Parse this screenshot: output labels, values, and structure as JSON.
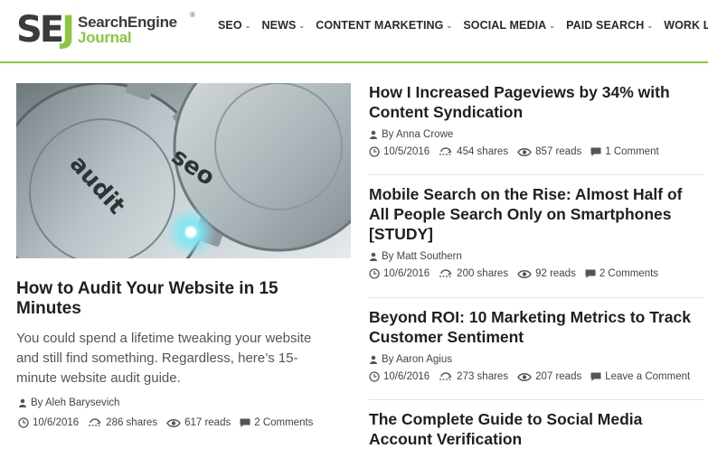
{
  "logo": {
    "mark_se": "SE",
    "mark_j": "J",
    "line1": "SearchEngine",
    "line2": "Journal",
    "reg": "®"
  },
  "nav": [
    {
      "label": "SEO"
    },
    {
      "label": "NEWS"
    },
    {
      "label": "CONTENT MARKETING"
    },
    {
      "label": "SOCIAL MEDIA"
    },
    {
      "label": "PAID SEARCH"
    },
    {
      "label": "WORK LIFE"
    }
  ],
  "featured": {
    "image_words": [
      "audit",
      "seo"
    ],
    "title": "How to Audit Your Website in 15 Minutes",
    "excerpt": "You could spend a lifetime tweaking your website and still find something. Regardless, here’s 15-minute website audit guide.",
    "author": "By Aleh Barysevich",
    "date": "10/6/2016",
    "shares": "286 shares",
    "reads": "617 reads",
    "comments": "2 Comments"
  },
  "articles": [
    {
      "title": "How I Increased Pageviews by 34% with Content Syndication",
      "author": "By Anna Crowe",
      "date": "10/5/2016",
      "shares": "454 shares",
      "reads": "857 reads",
      "comments": "1 Comment"
    },
    {
      "title": "Mobile Search on the Rise: Almost Half of All People Search Only on Smartphones [STUDY]",
      "author": "By Matt Southern",
      "date": "10/6/2016",
      "shares": "200 shares",
      "reads": "92 reads",
      "comments": "2 Comments"
    },
    {
      "title": "Beyond ROI: 10 Marketing Metrics to Track Customer Sentiment",
      "author": "By Aaron Agius",
      "date": "10/6/2016",
      "shares": "273 shares",
      "reads": "207 reads",
      "comments": "Leave a Comment"
    },
    {
      "title": "The Complete Guide to Social Media Account Verification"
    }
  ],
  "colors": {
    "brand_green": "#8cc63f",
    "brand_dark": "#3b3b3b",
    "text": "#1f1f1f"
  },
  "icons": [
    "user-icon",
    "clock-icon",
    "share-icon",
    "eye-icon",
    "comment-icon",
    "chevron-down-icon"
  ]
}
